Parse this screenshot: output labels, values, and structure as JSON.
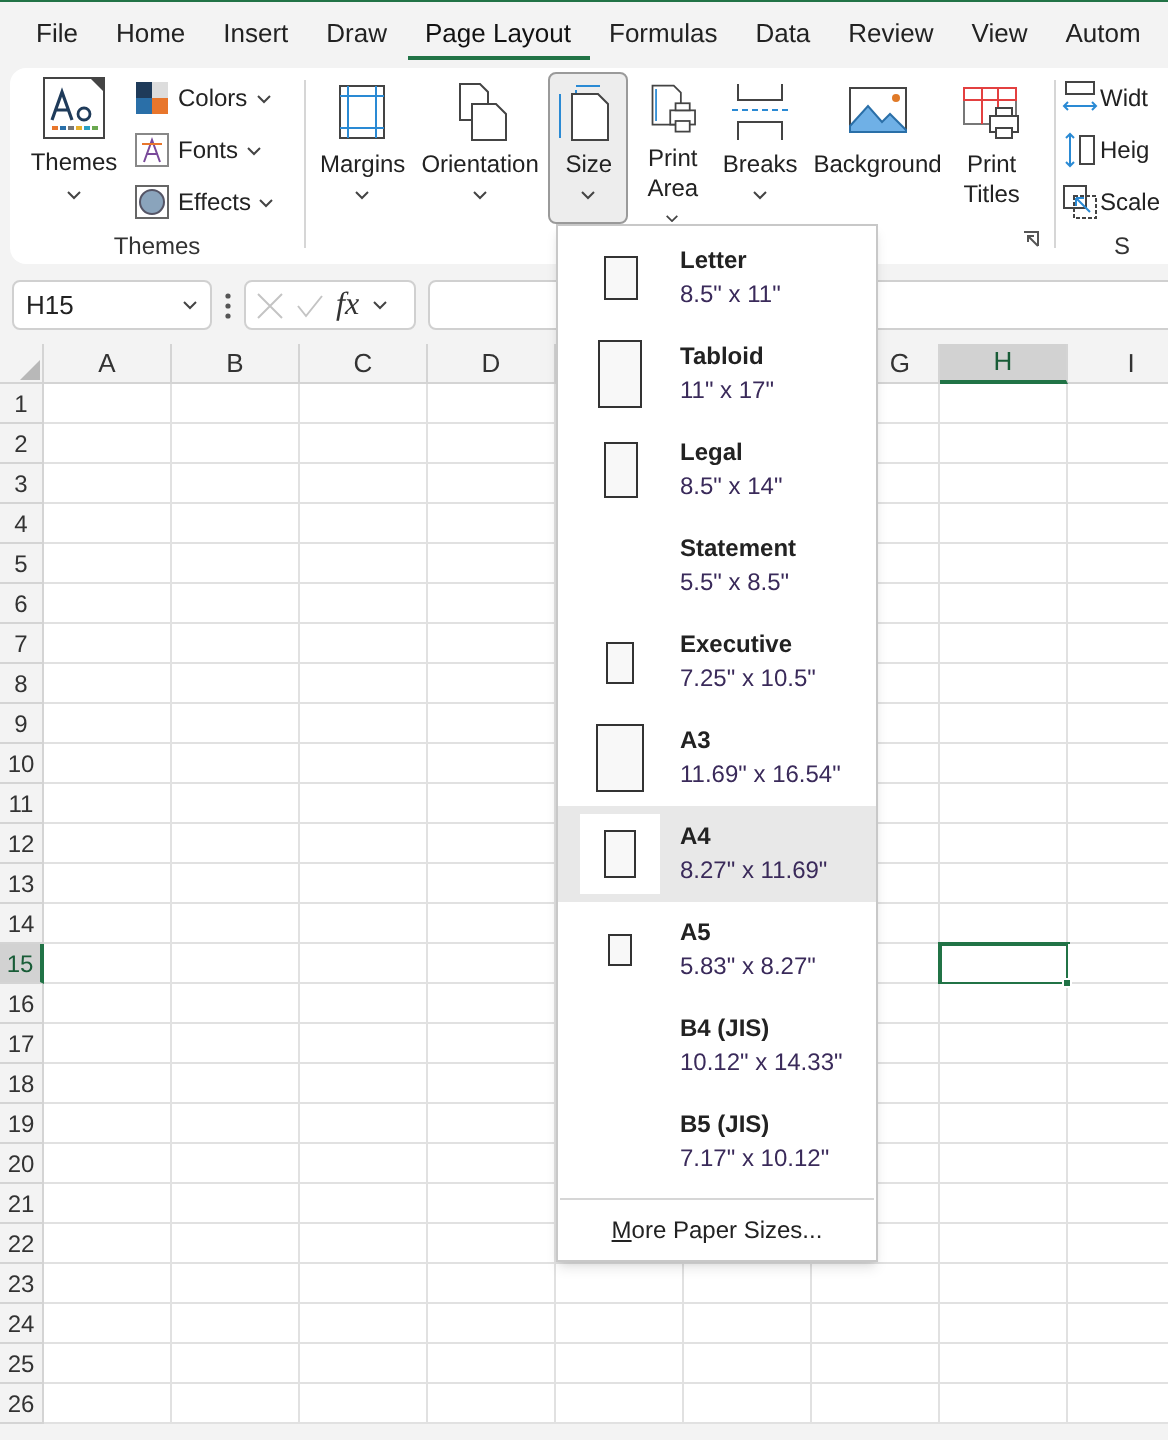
{
  "tabs": [
    {
      "label": "File",
      "selected": false
    },
    {
      "label": "Home",
      "selected": false
    },
    {
      "label": "Insert",
      "selected": false
    },
    {
      "label": "Draw",
      "selected": false
    },
    {
      "label": "Page Layout",
      "selected": true
    },
    {
      "label": "Formulas",
      "selected": false
    },
    {
      "label": "Data",
      "selected": false
    },
    {
      "label": "Review",
      "selected": false
    },
    {
      "label": "View",
      "selected": false
    },
    {
      "label": "Autom",
      "selected": false
    }
  ],
  "ribbon": {
    "themes_group": {
      "label": "Themes",
      "big": {
        "label": "Themes"
      },
      "small": [
        {
          "label": "Colors",
          "kind": "colors"
        },
        {
          "label": "Fonts",
          "kind": "fonts"
        },
        {
          "label": "Effects",
          "kind": "effects"
        }
      ]
    },
    "page_setup": [
      {
        "label": "Margins",
        "kind": "margins",
        "caret": true,
        "selected": false
      },
      {
        "label": "Orientation",
        "kind": "orientation",
        "caret": true,
        "selected": false
      },
      {
        "label": "Size",
        "kind": "size",
        "caret": true,
        "selected": true
      },
      {
        "label": "Print Area",
        "kind": "printarea",
        "caret": true,
        "selected": false
      },
      {
        "label": "Breaks",
        "kind": "breaks",
        "caret": true,
        "selected": false
      },
      {
        "label": "Background",
        "kind": "background",
        "caret": false,
        "selected": false
      },
      {
        "label": "Print Titles",
        "kind": "printtitles",
        "caret": false,
        "selected": false
      }
    ],
    "scale_group": {
      "items": [
        {
          "label": "Widt",
          "kind": "width"
        },
        {
          "label": "Heig",
          "kind": "height"
        },
        {
          "label": "Scale",
          "kind": "scale"
        }
      ],
      "label": "S"
    }
  },
  "formula_bar": {
    "name_box": "H15",
    "fx": "fx"
  },
  "sheet": {
    "columns": [
      {
        "label": "A",
        "selected": false
      },
      {
        "label": "B",
        "selected": false
      },
      {
        "label": "C",
        "selected": false
      },
      {
        "label": "D",
        "selected": false
      },
      {
        "label": "G",
        "selected": false
      },
      {
        "label": "H",
        "selected": true
      },
      {
        "label": "I",
        "selected": false
      }
    ],
    "rows": [
      {
        "label": "1",
        "selected": false
      },
      {
        "label": "2",
        "selected": false
      },
      {
        "label": "3",
        "selected": false
      },
      {
        "label": "4",
        "selected": false
      },
      {
        "label": "5",
        "selected": false
      },
      {
        "label": "6",
        "selected": false
      },
      {
        "label": "7",
        "selected": false
      },
      {
        "label": "8",
        "selected": false
      },
      {
        "label": "9",
        "selected": false
      },
      {
        "label": "10",
        "selected": false
      },
      {
        "label": "11",
        "selected": false
      },
      {
        "label": "12",
        "selected": false
      },
      {
        "label": "13",
        "selected": false
      },
      {
        "label": "14",
        "selected": false
      },
      {
        "label": "15",
        "selected": true
      },
      {
        "label": "16",
        "selected": false
      },
      {
        "label": "17",
        "selected": false
      },
      {
        "label": "18",
        "selected": false
      },
      {
        "label": "19",
        "selected": false
      },
      {
        "label": "20",
        "selected": false
      },
      {
        "label": "21",
        "selected": false
      },
      {
        "label": "22",
        "selected": false
      },
      {
        "label": "23",
        "selected": false
      },
      {
        "label": "24",
        "selected": false
      },
      {
        "label": "25",
        "selected": false
      },
      {
        "label": "26",
        "selected": false
      }
    ]
  },
  "size_menu": {
    "items": [
      {
        "name": "Letter",
        "dims": "8.5\" x 11\"",
        "kind": "icon",
        "selected": false
      },
      {
        "name": "Tabloid",
        "dims": "11\" x 17\"",
        "kind": "icon",
        "selected": false
      },
      {
        "name": "Legal",
        "dims": "8.5\" x 14\"",
        "kind": "icon",
        "selected": false
      },
      {
        "name": "Statement",
        "dims": "5.5\" x 8.5\"",
        "kind": "plain",
        "selected": false
      },
      {
        "name": "Executive",
        "dims": "7.25\" x 10.5\"",
        "kind": "icon",
        "selected": false
      },
      {
        "name": "A3",
        "dims": "11.69\" x 16.54\"",
        "kind": "icon",
        "selected": false
      },
      {
        "name": "A4",
        "dims": "8.27\" x 11.69\"",
        "kind": "icon",
        "selected": true
      },
      {
        "name": "A5",
        "dims": "5.83\" x 8.27\"",
        "kind": "icon",
        "selected": false
      },
      {
        "name": "B4 (JIS)",
        "dims": "10.12\" x 14.33\"",
        "kind": "plain",
        "selected": false
      },
      {
        "name": "B5 (JIS)",
        "dims": "7.17\" x 10.12\"",
        "kind": "plain",
        "selected": false
      }
    ],
    "more": "More Paper Sizes..."
  }
}
